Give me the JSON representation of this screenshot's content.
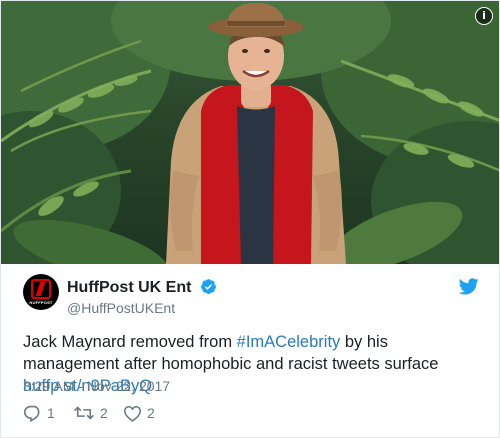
{
  "media": {
    "info_icon": "info-icon",
    "colors": {
      "jungle_dark": "#1d3520",
      "jungle_mid": "#3f6b3a",
      "leaf": "#6f9a4e",
      "gilet": "#c4161c",
      "shirt": "#c9a27a",
      "hat": "#9c7147"
    }
  },
  "tweet": {
    "avatar_wordmark": "HUFFPOST",
    "display_name": "HuffPost UK Ent",
    "verified_icon": "verified-badge-icon",
    "handle": "@HuffPostUKEnt",
    "bird_icon": "twitter-bird-icon",
    "text_part1": "Jack Maynard removed from ",
    "hashtag": "#ImACelebrity",
    "text_part2": " by his management after homophobic and racist tweets surface ",
    "link": "huffp.st/n9PaByQ",
    "timestamp": "3:29 AM - Nov 22, 2017",
    "actions": {
      "reply_count": "1",
      "retweet_count": "2",
      "like_count": "2"
    },
    "colors": {
      "link": "#2b7bb9",
      "muted": "#697882",
      "text": "#1c2022",
      "verified": "#1da1f2"
    }
  }
}
